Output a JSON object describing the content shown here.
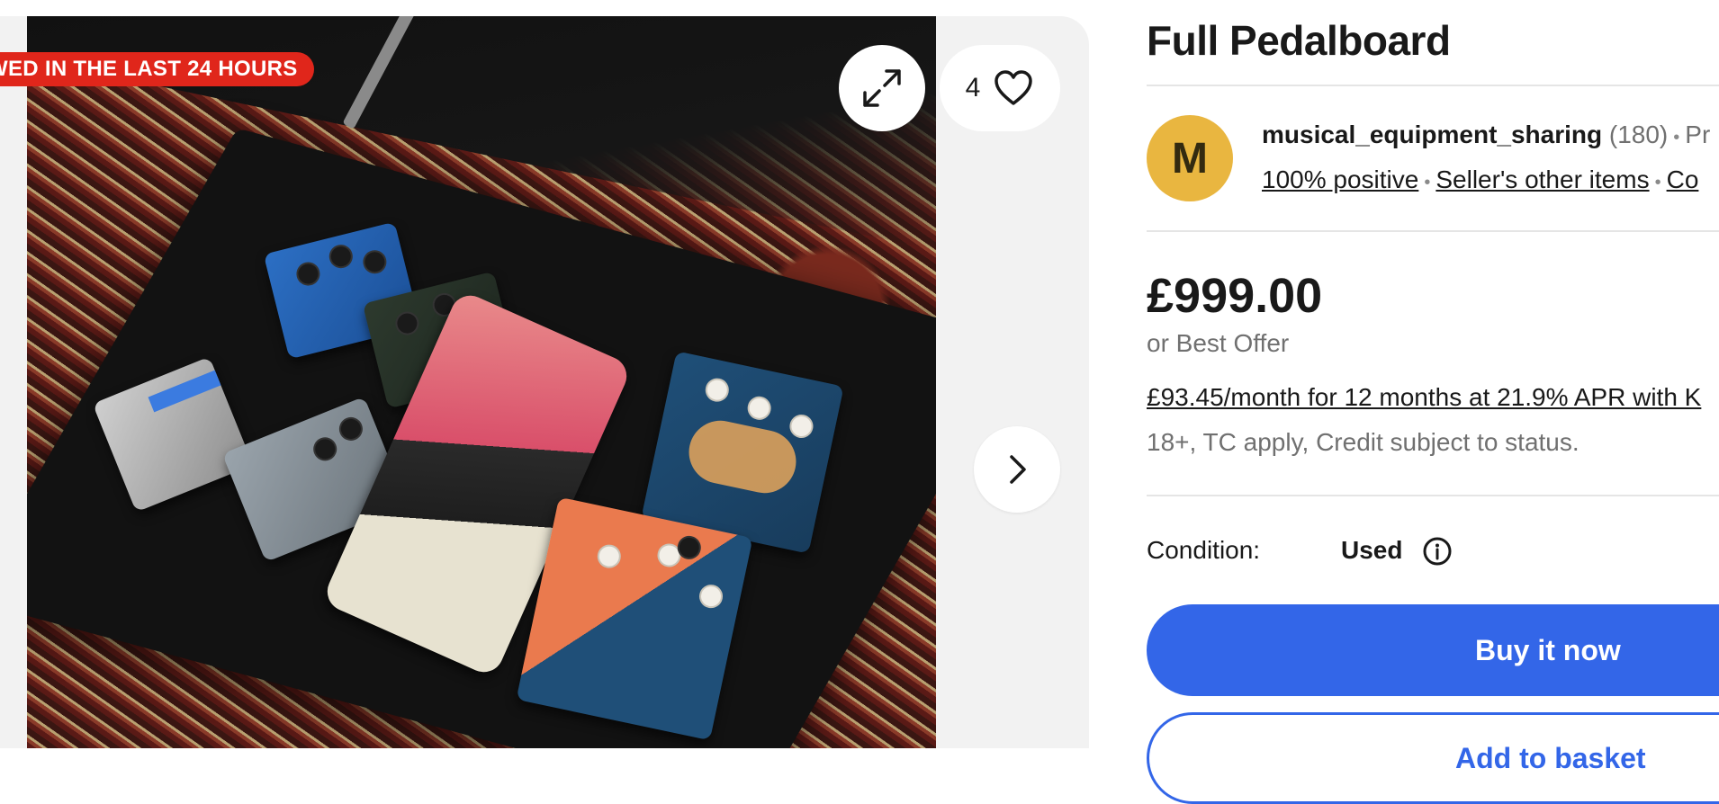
{
  "gallery": {
    "badge": "WED IN THE LAST 24 HOURS",
    "favorite_count": "4",
    "expand_icon": "expand-icon",
    "heart_icon": "heart-icon",
    "next_icon": "chevron-right-icon",
    "badge_color": "#e0261b"
  },
  "listing": {
    "title": "Full Pedalboard",
    "seller": {
      "avatar_letter": "M",
      "avatar_color": "#e9b640",
      "name": "musical_equipment_sharing",
      "feedback_count": "(180)",
      "trailing": "Pr",
      "positive": "100% positive",
      "other_items": "Seller's other items",
      "contact": "Co"
    },
    "price": "£999.00",
    "best_offer": "or Best Offer",
    "finance_link": "£93.45/month for 12 months at 21.9% APR with K",
    "credit_note": "18+, TC apply, Credit subject to status.",
    "condition_label": "Condition:",
    "condition_value": "Used",
    "buy_now": "Buy it now",
    "add_to_basket": "Add to basket",
    "accent_color": "#3366e8"
  }
}
